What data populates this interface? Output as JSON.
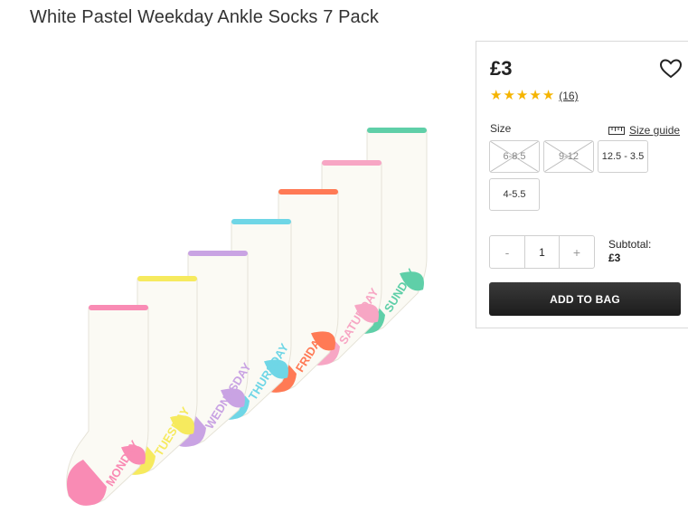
{
  "product": {
    "title": "White Pastel Weekday Ankle Socks 7 Pack",
    "price": "£3",
    "rating": 5,
    "rating_count": "(16)",
    "image_label": "socks-7-pack-image"
  },
  "sizes": {
    "label": "Size",
    "guide_label": "Size guide",
    "options": [
      {
        "label": "6-8.5",
        "available": false
      },
      {
        "label": "9-12",
        "available": false
      },
      {
        "label": "12.5 - 3.5",
        "available": true
      },
      {
        "label": "4-5.5",
        "available": true
      }
    ]
  },
  "quantity": {
    "minus": "-",
    "value": "1",
    "plus": "+"
  },
  "subtotal": {
    "label": "Subtotal:",
    "amount": "£3"
  },
  "add_to_bag": "ADD TO BAG",
  "sock_days": [
    "MONDAY",
    "TUESDAY",
    "WEDNESDAY",
    "THURSDAY",
    "FRIDAY",
    "SATURDAY",
    "SUNDAY"
  ],
  "colors": {
    "star": "#f5b400",
    "button_bg": "#222222",
    "monday": "#f98bb4",
    "tuesday": "#f6ea5e",
    "wednesday": "#c9a3e3",
    "thursday": "#6fd6e6",
    "friday": "#ff7a55",
    "saturday": "#f7a6c4",
    "sunday": "#5fcfa8"
  }
}
